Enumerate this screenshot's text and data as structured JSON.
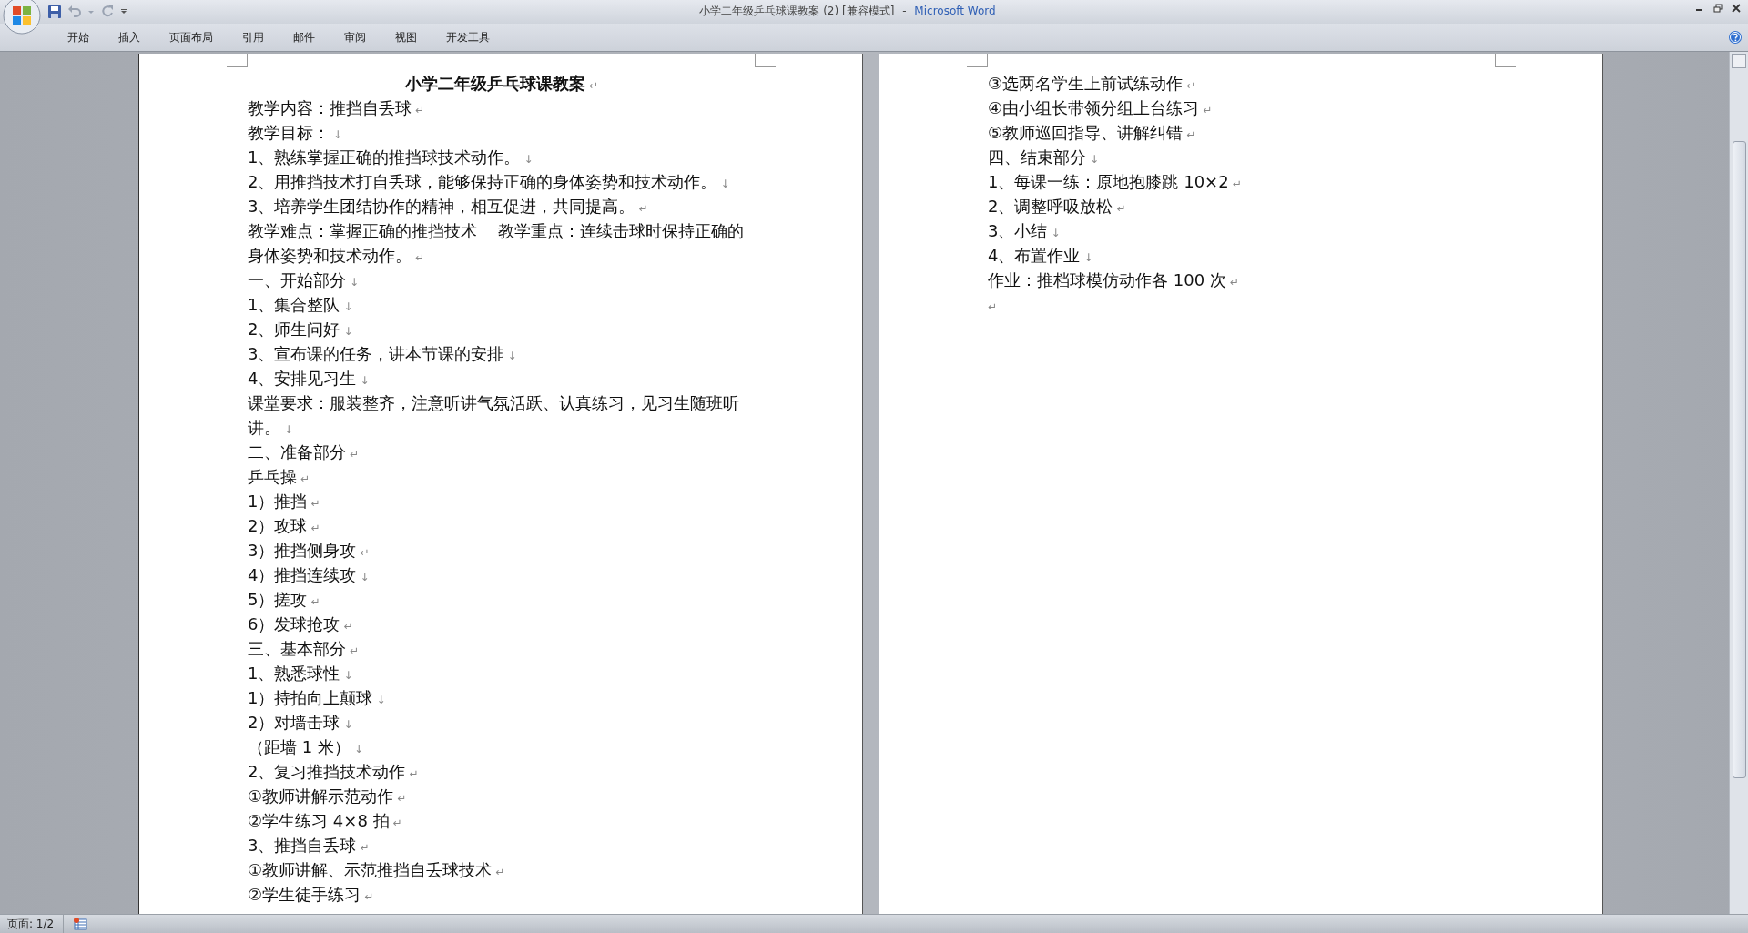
{
  "window": {
    "title": "小学二年级乒乓球课教案 (2) [兼容模式]",
    "separator": "-",
    "app_name": "Microsoft Word"
  },
  "ribbon": {
    "tabs": [
      "开始",
      "插入",
      "页面布局",
      "引用",
      "邮件",
      "审阅",
      "视图",
      "开发工具"
    ]
  },
  "document": {
    "pages": [
      {
        "lines": [
          {
            "kind": "title",
            "text": "小学二年级乒乓球课教案",
            "mark": "↵"
          },
          {
            "kind": "body",
            "text": "教学内容：推挡自丢球",
            "mark": "↵"
          },
          {
            "kind": "body",
            "text": "教学目标：",
            "mark": "↓"
          },
          {
            "kind": "body",
            "text": "1、熟练掌握正确的推挡球技术动作。",
            "mark": "↓"
          },
          {
            "kind": "body",
            "text": "2、用推挡技术打自丢球，能够保持正确的身体姿势和技术动作。",
            "mark": "↓"
          },
          {
            "kind": "body",
            "text": "3、培养学生团结协作的精神，相互促进，共同提高。",
            "mark": "↵"
          },
          {
            "kind": "body",
            "text": "教学难点：掌握正确的推挡技术    教学重点：连续击球时保持正确的身体姿势和技术动作。",
            "mark": "↵"
          },
          {
            "kind": "body",
            "text": "一、开始部分",
            "mark": "↓"
          },
          {
            "kind": "body",
            "text": "1、集合整队",
            "mark": "↓"
          },
          {
            "kind": "body",
            "text": "2、师生问好",
            "mark": "↓"
          },
          {
            "kind": "body",
            "text": "3、宣布课的任务，讲本节课的安排",
            "mark": "↓"
          },
          {
            "kind": "body",
            "text": "4、安排见习生",
            "mark": "↓"
          },
          {
            "kind": "body",
            "text": "课堂要求：服装整齐，注意听讲气氛活跃、认真练习，见习生随班听讲。",
            "mark": "↓"
          },
          {
            "kind": "body",
            "text": "二、准备部分",
            "mark": "↵"
          },
          {
            "kind": "body",
            "text": "乒乓操",
            "mark": "↵"
          },
          {
            "kind": "body",
            "text": "1）推挡",
            "mark": "↵"
          },
          {
            "kind": "body",
            "text": "2）攻球",
            "mark": "↵"
          },
          {
            "kind": "body",
            "text": "3）推挡侧身攻",
            "mark": "↵"
          },
          {
            "kind": "body",
            "text": "4）推挡连续攻",
            "mark": "↓"
          },
          {
            "kind": "body",
            "text": "5）搓攻",
            "mark": "↵"
          },
          {
            "kind": "body",
            "text": "6）发球抢攻",
            "mark": "↵"
          },
          {
            "kind": "body",
            "text": "三、基本部分",
            "mark": "↵"
          },
          {
            "kind": "body",
            "text": "1、熟悉球性",
            "mark": "↓"
          },
          {
            "kind": "body",
            "text": "1）持拍向上颠球",
            "mark": "↓"
          },
          {
            "kind": "body",
            "text": "2）对墙击球",
            "mark": "↓"
          },
          {
            "kind": "body",
            "text": "（距墙 1 米）",
            "mark": "↓"
          },
          {
            "kind": "body",
            "text": "2、复习推挡技术动作",
            "mark": "↵"
          },
          {
            "kind": "body",
            "text": "①教师讲解示范动作",
            "mark": "↵"
          },
          {
            "kind": "body",
            "text": "②学生练习 4×8 拍",
            "mark": "↵"
          },
          {
            "kind": "body",
            "text": "3、推挡自丢球",
            "mark": "↵"
          },
          {
            "kind": "body",
            "text": "①教师讲解、示范推挡自丢球技术",
            "mark": "↵"
          },
          {
            "kind": "body",
            "text": "②学生徒手练习",
            "mark": "↵"
          }
        ]
      },
      {
        "lines": [
          {
            "kind": "body",
            "text": "③选两名学生上前试练动作",
            "mark": "↵"
          },
          {
            "kind": "body",
            "text": "④由小组长带领分组上台练习",
            "mark": "↵"
          },
          {
            "kind": "body",
            "text": "⑤教师巡回指导、讲解纠错",
            "mark": "↵"
          },
          {
            "kind": "body",
            "text": "四、结束部分",
            "mark": "↓"
          },
          {
            "kind": "body",
            "text": "1、每课一练：原地抱膝跳 10×2",
            "mark": "↵"
          },
          {
            "kind": "body",
            "text": "2、调整呼吸放松",
            "mark": "↵"
          },
          {
            "kind": "body",
            "text": "3、小结",
            "mark": "↓"
          },
          {
            "kind": "body",
            "text": "4、布置作业",
            "mark": "↓"
          },
          {
            "kind": "body",
            "text": "作业：推档球模仿动作各 100 次",
            "mark": "↵"
          },
          {
            "kind": "empty",
            "mark": "↵"
          }
        ]
      }
    ]
  },
  "status_bar": {
    "page": "页面: 1/2"
  }
}
